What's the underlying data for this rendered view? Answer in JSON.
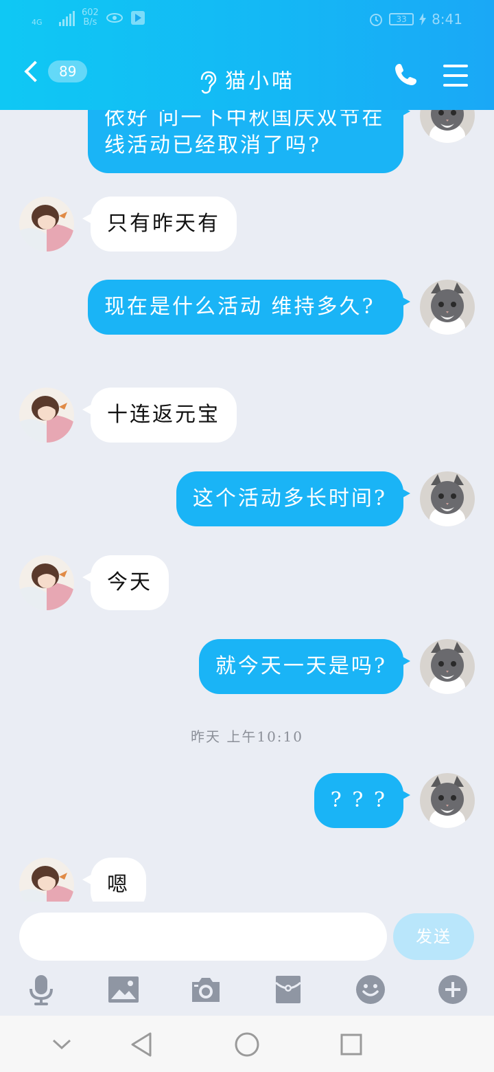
{
  "status": {
    "signal_label": "4G",
    "net_speed_value": "602",
    "net_speed_unit": "B/s",
    "battery": "33",
    "time": "8:41"
  },
  "header": {
    "back_badge": "89",
    "title": "猫小喵"
  },
  "messages": [
    {
      "side": "out",
      "text": "依好  问一下中秋国庆双节在线活动已经取消了吗?"
    },
    {
      "side": "in",
      "text": "只有昨天有"
    },
    {
      "side": "out",
      "text": "现在是什么活动 维持多久?"
    },
    {
      "side": "in",
      "text": "十连返元宝"
    },
    {
      "side": "out",
      "text": "这个活动多长时间?"
    },
    {
      "side": "in",
      "text": "今天"
    },
    {
      "side": "out",
      "text": "就今天一天是吗?"
    },
    {
      "side": "time",
      "text": "昨天 上午10:10"
    },
    {
      "side": "out",
      "text": "? ? ?"
    },
    {
      "side": "in",
      "text": "嗯"
    }
  ],
  "composer": {
    "input_value": "",
    "send_label": "发送"
  },
  "toolbar": {
    "icons": [
      "microphone-icon",
      "image-icon",
      "camera-icon",
      "red-packet-icon",
      "emoji-icon",
      "plus-icon"
    ]
  },
  "navbar": {
    "icons": [
      "collapse-chevron-icon",
      "back-triangle-icon",
      "home-circle-icon",
      "recents-square-icon"
    ]
  },
  "colors": {
    "accent": "#14b8f5",
    "outgoing_bubble": "#1ab4f6",
    "incoming_bubble": "#ffffff",
    "background": "#eaedf4",
    "send_disabled": "#b9e6fb"
  }
}
